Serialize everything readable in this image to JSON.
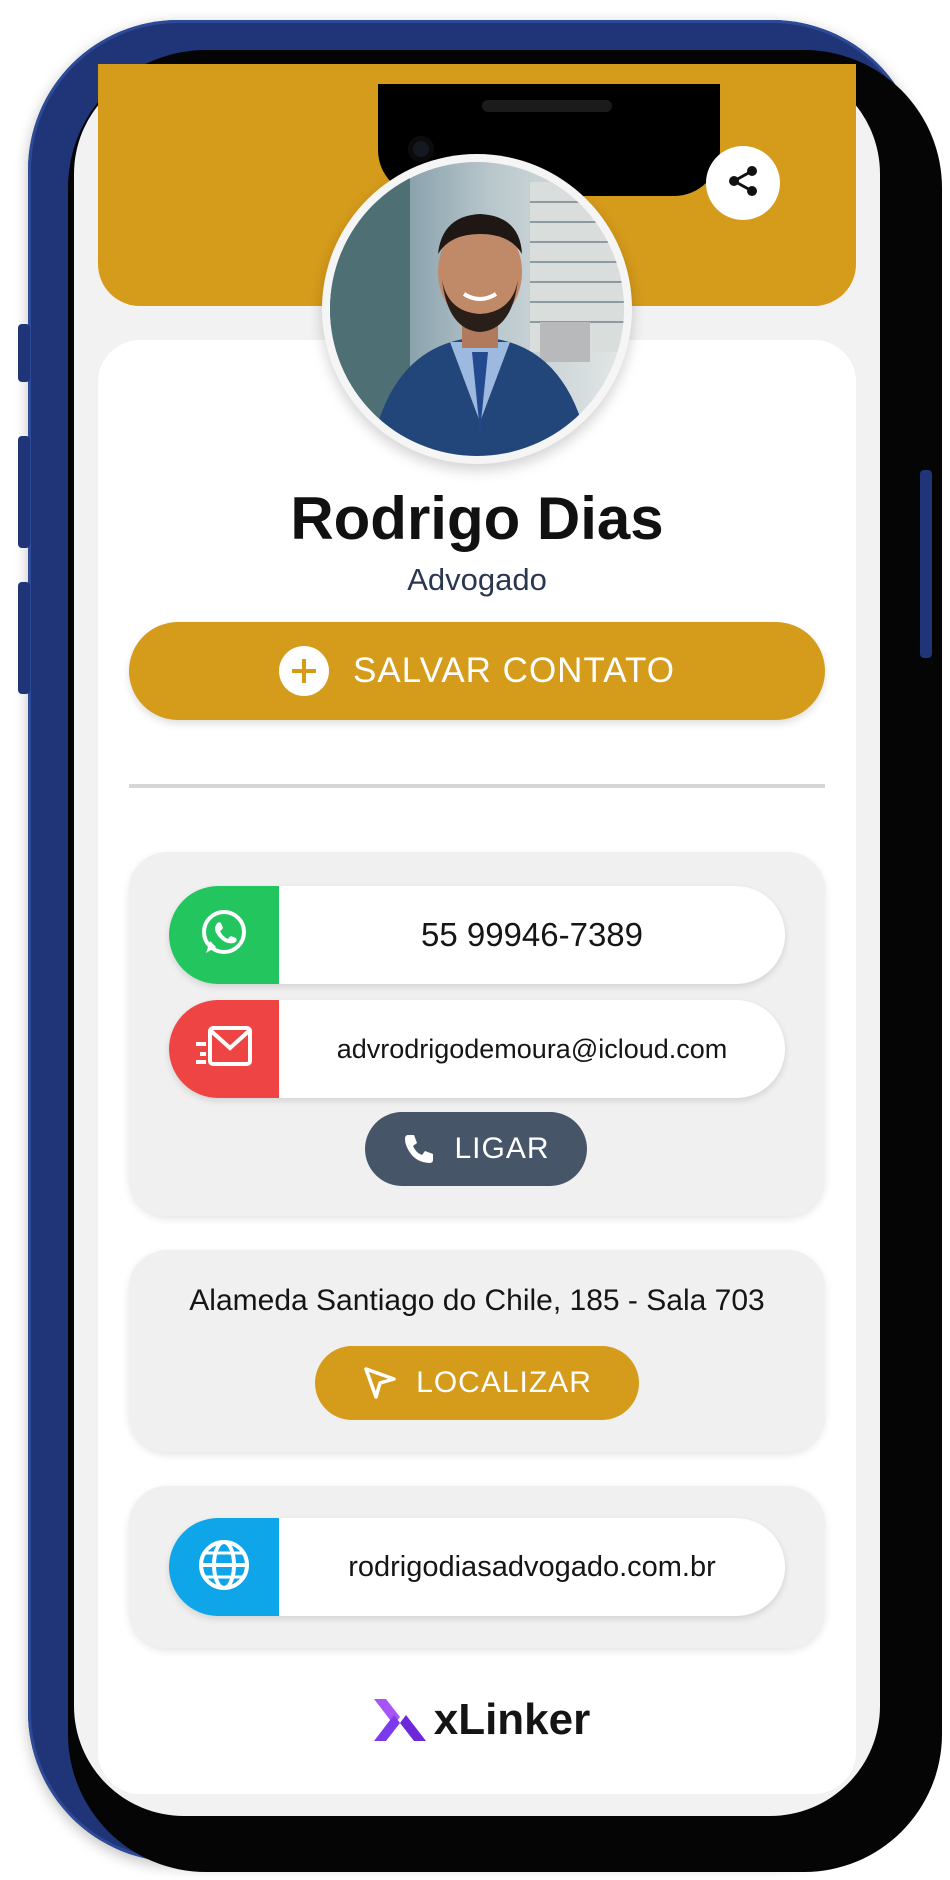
{
  "profile": {
    "name": "Rodrigo Dias",
    "title": "Advogado"
  },
  "actions": {
    "save_contact_label": "SALVAR CONTATO",
    "call_label": "LIGAR",
    "locate_label": "LOCALIZAR"
  },
  "contacts": {
    "whatsapp": "55 99946-7389",
    "email": "advrodrigodemoura@icloud.com",
    "website": "rodrigodiasadvogado.com.br"
  },
  "address": {
    "text": "Alameda Santiago do Chile, 185 - Sala 703"
  },
  "footer": {
    "brand": "xLinker"
  },
  "icons": {
    "share": "share-icon",
    "save": "plus-circle-icon",
    "whatsapp": "whatsapp-icon",
    "email": "mail-icon",
    "call": "phone-icon",
    "locate": "navigation-arrow-icon",
    "website": "globe-icon"
  },
  "colors": {
    "accent": "#d59b1b",
    "whatsapp": "#22c55e",
    "email": "#ef4444",
    "call_button": "#475569",
    "website": "#0ea5e9",
    "phone_frame": "#1f3578",
    "brand_purple": "#8b3cf0"
  }
}
